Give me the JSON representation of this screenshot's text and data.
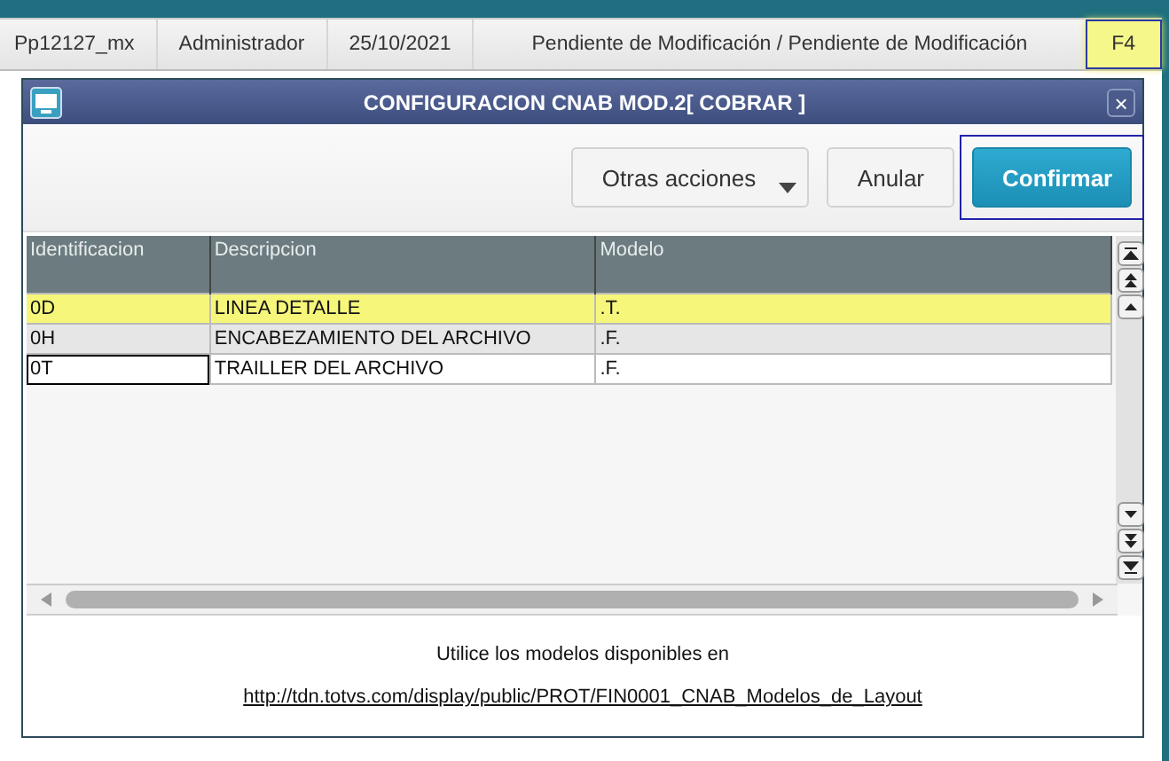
{
  "status_bar": [
    {
      "text": "Pp12127_mx",
      "highlighted": false
    },
    {
      "text": "Administrador",
      "highlighted": false
    },
    {
      "text": "25/10/2021",
      "highlighted": false
    },
    {
      "text": "Pendiente de Modificación / Pendiente de Modificación",
      "highlighted": false
    },
    {
      "text": "F4",
      "highlighted": true
    }
  ],
  "dialog": {
    "title": "CONFIGURACION CNAB MOD.2[ COBRAR ]",
    "close": "×",
    "buttons": [
      {
        "label": "Otras acciones",
        "kind": "menu",
        "highlighted": false
      },
      {
        "label": "Anular",
        "kind": "plain",
        "highlighted": false
      },
      {
        "label": "Confirmar",
        "kind": "primary",
        "highlighted": true
      }
    ],
    "table": {
      "columns": [
        "Identificacion",
        "Descripcion",
        "Modelo"
      ],
      "rows": [
        {
          "cells": [
            "0D",
            "LINEA DETALLE",
            ".T."
          ],
          "highlighted": true,
          "focused_cell": false
        },
        {
          "cells": [
            "0H",
            "ENCABEZAMIENTO DEL ARCHIVO",
            ".F."
          ],
          "highlighted": false,
          "focused_cell": false
        },
        {
          "cells": [
            "0T",
            "TRAILLER DEL ARCHIVO",
            ".F."
          ],
          "highlighted": false,
          "focused_cell": true
        }
      ]
    },
    "note": "Utilice los modelos disponibles en",
    "link": "http://tdn.totvs.com/display/public/PROT/FIN0001_CNAB_Modelos_de_Layout"
  }
}
